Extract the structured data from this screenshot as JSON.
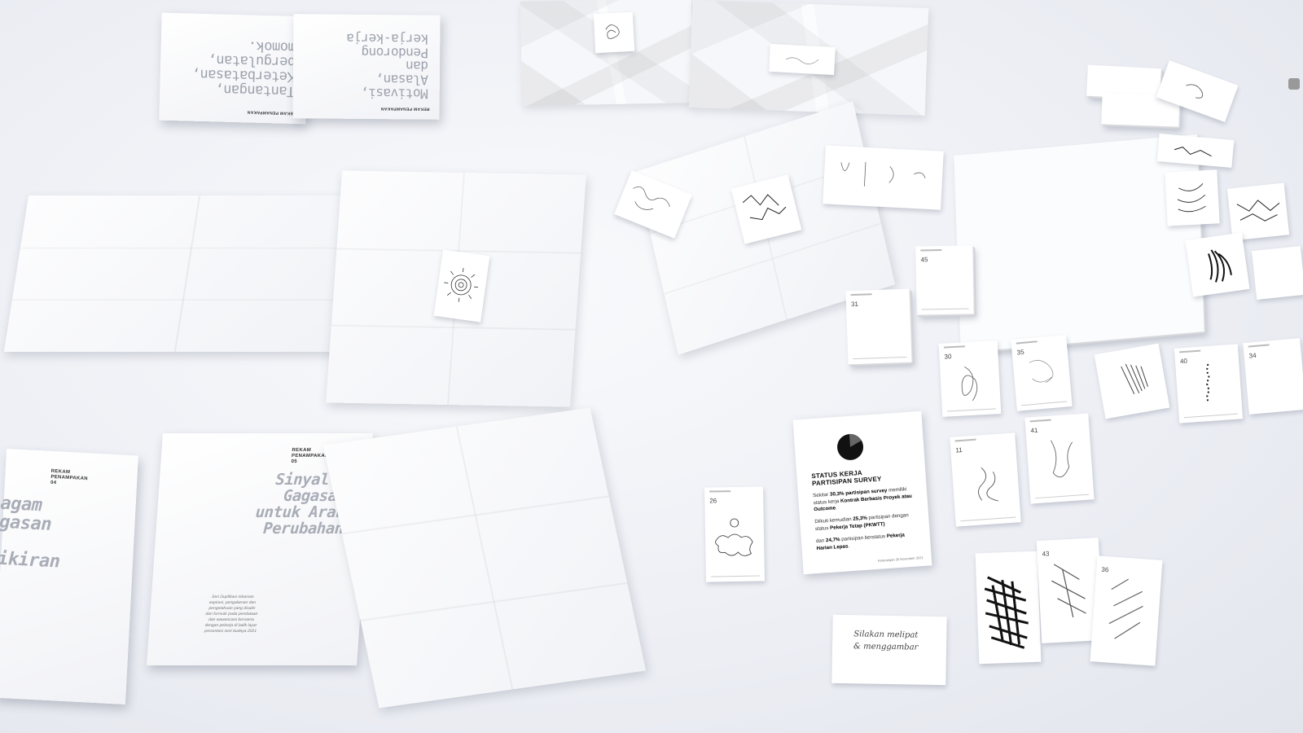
{
  "scene": {
    "description_alt": ""
  },
  "booklets": {
    "top_left_a": {
      "label": "REKAM PENAMPAKAN",
      "title_lines": [
        "Tantangan,",
        "Keterbatasan,",
        "pergulatan,",
        "momok."
      ]
    },
    "top_left_b": {
      "label": "REKAM PENAMPAKAN",
      "title_lines": [
        "Motivasi,",
        "Alasan,",
        "dan",
        "Pendorong",
        "kerja-kerja"
      ]
    },
    "bottom_left": {
      "label_lines": [
        "REKAM",
        "PENAMPAKAN",
        "04"
      ],
      "title_lines": [
        "agam",
        "gasan",
        "",
        "ikiran"
      ]
    },
    "bottom_center": {
      "label_lines": [
        "REKAM",
        "PENAMPAKAN",
        "05"
      ],
      "title_lines": [
        "Sinyal &",
        "Gagasan",
        "untuk Arah",
        "Perubahan"
      ],
      "blurb_lines": [
        "Seri Dupfikasi rekaman",
        "aspirasi, pengalaman dan",
        "pengetahuan yang disalin",
        "dari formulir pada pendataan",
        "dan wawancara bersama",
        "dengan pekerja di balik layar",
        "presentasi seni budaya 2021"
      ]
    }
  },
  "survey_card": {
    "title_lines": [
      "STATUS KERJA",
      "PARTISIPAN SURVEY"
    ],
    "p1": {
      "pre": "Sekitar ",
      "b1": "30,3% partisipan survey",
      "mid": " memiliki status kerja ",
      "b2": "Kontrak Berbasis Proyek atau Outcome",
      "post": "."
    },
    "p2": {
      "pre": "Diikuti kemudian ",
      "b1": "25,3%",
      "mid": " partisipan dengan status ",
      "b2": "Pekerja Tetap (PKWTT)"
    },
    "p3": {
      "pre": "dan ",
      "b1": "24,7%",
      "mid": " partisipan berstatus ",
      "b2": "Pekerja Harian Lepas",
      "post": "."
    },
    "footer": "Keterangan 30 November 2021"
  },
  "handwritten_card": {
    "lines": [
      "Silakan melipat",
      "& menggambar"
    ]
  },
  "card_numbers": {
    "c26": "26",
    "c31": "31",
    "c45": "45",
    "c30": "30",
    "c35": "35",
    "c40": "40",
    "c11": "11",
    "c41": "41",
    "c43": "43",
    "c36": "36",
    "c34": "34"
  }
}
